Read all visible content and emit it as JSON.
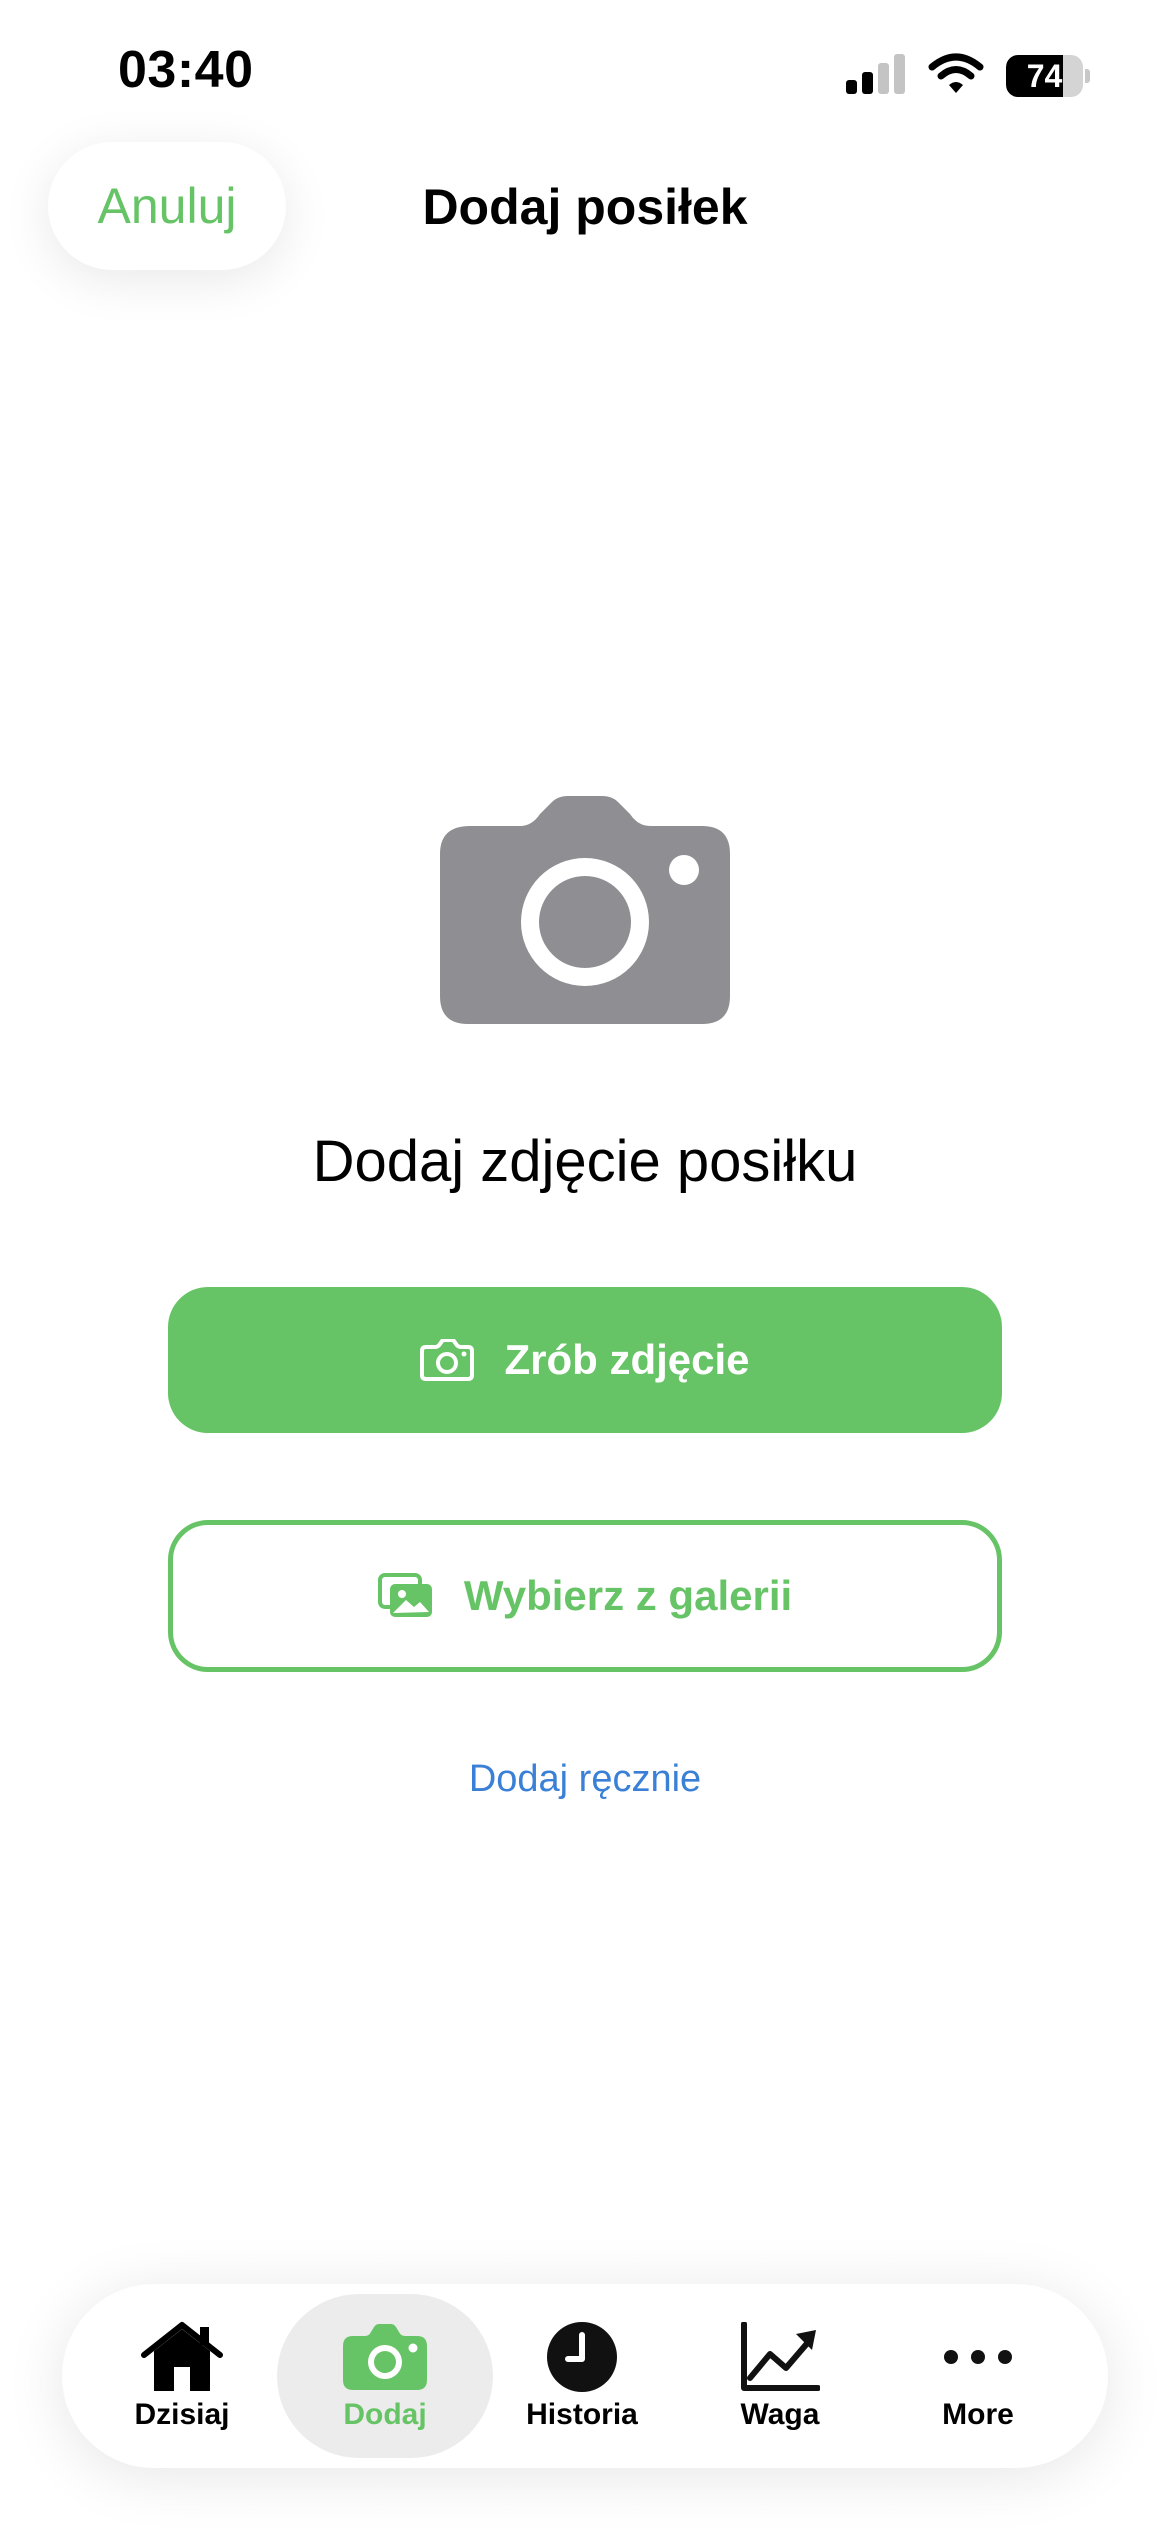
{
  "status_bar": {
    "time": "03:40",
    "battery_level": "74",
    "battery_fraction": 0.74,
    "signal_icon": "cellular-signal-icon",
    "wifi_icon": "wifi-icon"
  },
  "nav": {
    "cancel_label": "Anuluj",
    "title": "Dodaj posiłek"
  },
  "hero": {
    "icon": "camera-icon",
    "title": "Dodaj zdjęcie posiłku"
  },
  "actions": {
    "take_photo": {
      "label": "Zrób zdjęcie",
      "icon": "camera-icon"
    },
    "choose_gallery": {
      "label": "Wybierz z galerii",
      "icon": "photo-gallery-icon"
    },
    "add_manually": {
      "label": "Dodaj ręcznie"
    }
  },
  "tabbar": {
    "active_index": 1,
    "items": [
      {
        "label": "Dzisiaj",
        "icon": "house-icon"
      },
      {
        "label": "Dodaj",
        "icon": "camera-icon"
      },
      {
        "label": "Historia",
        "icon": "clock-icon"
      },
      {
        "label": "Waga",
        "icon": "chart-line-icon"
      },
      {
        "label": "More",
        "icon": "ellipsis-icon"
      }
    ]
  },
  "colors": {
    "accent_green": "#67c466",
    "link_blue": "#3a80d6",
    "icon_gray": "#8e8e93",
    "active_tab_bg": "#ececec"
  }
}
